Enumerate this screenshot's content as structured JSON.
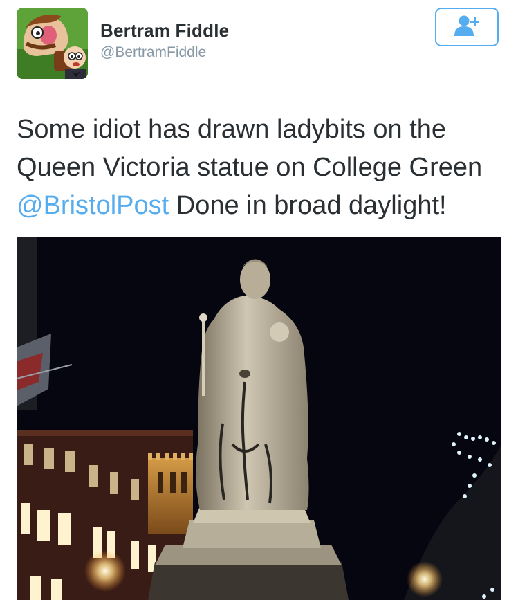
{
  "user": {
    "name": "Bertram Fiddle",
    "handle": "@BertramFiddle",
    "avatar_icon": "cartoon-characters-avatar"
  },
  "follow_button": {
    "icon": "add-user-icon",
    "color": "#55acee"
  },
  "tweet": {
    "text_before_mention": "Some idiot has drawn ladybits on the Queen Victoria statue on College Green ",
    "mention": "@BristolPost",
    "text_after_mention": " Done in broad daylight!"
  },
  "photo": {
    "subject": "night-photo-queen-victoria-statue"
  }
}
